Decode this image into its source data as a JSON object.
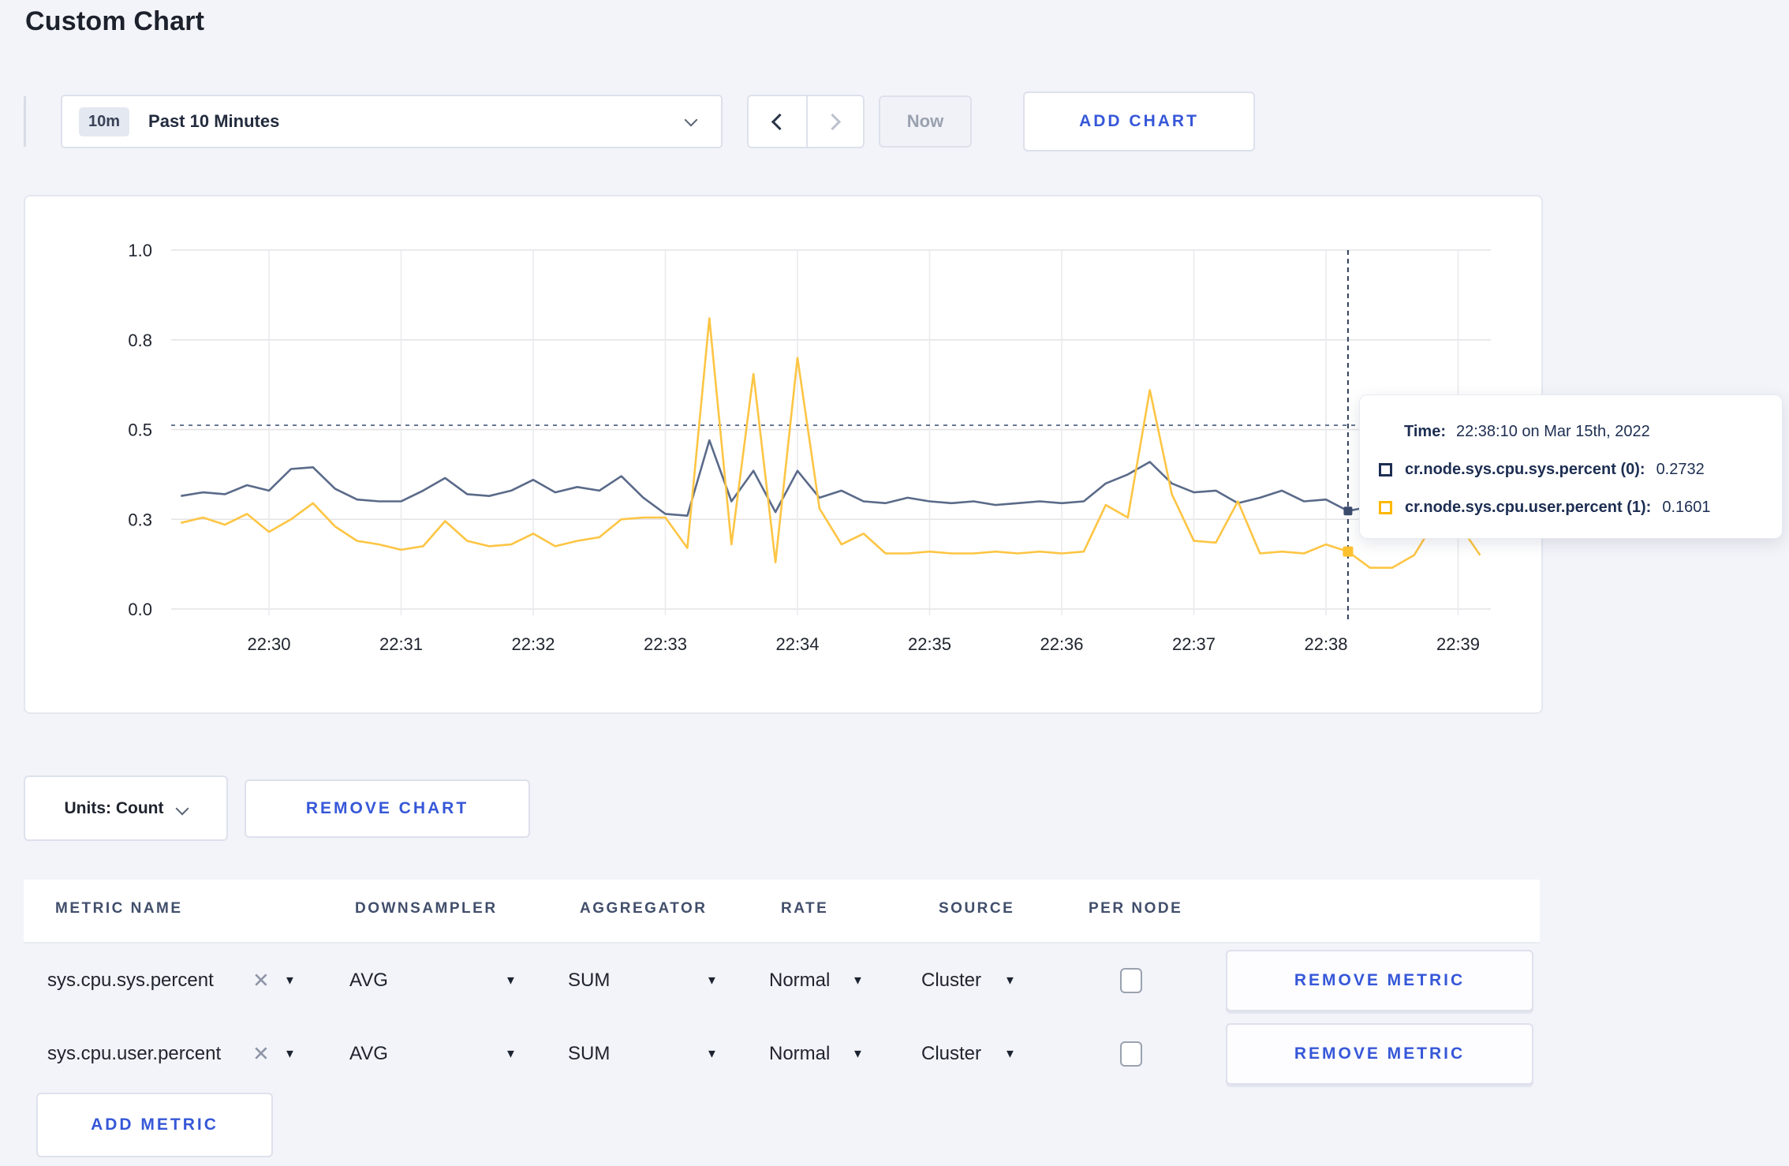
{
  "page_title": "Custom Chart",
  "toolbar": {
    "time_range_badge": "10m",
    "time_range_label": "Past 10 Minutes",
    "prev_label": "previous time window",
    "next_label": "next time window",
    "now_label": "Now",
    "add_chart_label": "ADD CHART",
    "icons": [
      "chevron-down-icon",
      "chevron-left-icon",
      "chevron-right-icon"
    ]
  },
  "chart_data": {
    "type": "line",
    "title": "",
    "xlabel": "",
    "ylabel": "",
    "ylim": [
      0,
      1
    ],
    "grid": true,
    "yticks": [
      {
        "value": 0,
        "label": "0.0"
      },
      {
        "value": 0.25,
        "label": "0.3"
      },
      {
        "value": 0.5,
        "label": "0.5"
      },
      {
        "value": 0.75,
        "label": "0.8"
      },
      {
        "value": 1,
        "label": "1.0"
      }
    ],
    "xticks": [
      "22:30",
      "22:31",
      "22:32",
      "22:33",
      "22:34",
      "22:35",
      "22:36",
      "22:37",
      "22:38",
      "22:39"
    ],
    "x": [
      "22:29:20",
      "22:29:30",
      "22:29:40",
      "22:29:50",
      "22:30:00",
      "22:30:10",
      "22:30:20",
      "22:30:30",
      "22:30:40",
      "22:30:50",
      "22:31:00",
      "22:31:10",
      "22:31:20",
      "22:31:30",
      "22:31:40",
      "22:31:50",
      "22:32:00",
      "22:32:10",
      "22:32:20",
      "22:32:30",
      "22:32:40",
      "22:32:50",
      "22:33:00",
      "22:33:10",
      "22:33:20",
      "22:33:30",
      "22:33:40",
      "22:33:50",
      "22:34:00",
      "22:34:10",
      "22:34:20",
      "22:34:30",
      "22:34:40",
      "22:34:50",
      "22:35:00",
      "22:35:10",
      "22:35:20",
      "22:35:30",
      "22:35:40",
      "22:35:50",
      "22:36:00",
      "22:36:10",
      "22:36:20",
      "22:36:30",
      "22:36:40",
      "22:36:50",
      "22:37:00",
      "22:37:10",
      "22:37:20",
      "22:37:30",
      "22:37:40",
      "22:37:50",
      "22:38:00",
      "22:38:10",
      "22:38:20",
      "22:38:30",
      "22:38:40",
      "22:38:50",
      "22:39:00",
      "22:39:10"
    ],
    "series": [
      {
        "name": "cr.node.sys.cpu.sys.percent (0)",
        "color": "#5a6a89",
        "values": [
          0.315,
          0.325,
          0.32,
          0.345,
          0.33,
          0.39,
          0.395,
          0.335,
          0.305,
          0.3,
          0.3,
          0.33,
          0.365,
          0.32,
          0.315,
          0.33,
          0.36,
          0.325,
          0.34,
          0.33,
          0.37,
          0.31,
          0.265,
          0.26,
          0.47,
          0.3,
          0.385,
          0.27,
          0.385,
          0.31,
          0.33,
          0.3,
          0.295,
          0.31,
          0.3,
          0.295,
          0.3,
          0.29,
          0.295,
          0.3,
          0.295,
          0.3,
          0.35,
          0.375,
          0.41,
          0.35,
          0.325,
          0.33,
          0.295,
          0.31,
          0.33,
          0.3,
          0.305,
          0.2732,
          0.285,
          0.29,
          0.295,
          0.3,
          0.295,
          0.3
        ]
      },
      {
        "name": "cr.node.sys.cpu.user.percent (1)",
        "color": "#fdc544",
        "values": [
          0.24,
          0.255,
          0.235,
          0.265,
          0.215,
          0.25,
          0.295,
          0.23,
          0.19,
          0.18,
          0.165,
          0.175,
          0.245,
          0.19,
          0.175,
          0.18,
          0.21,
          0.175,
          0.19,
          0.2,
          0.25,
          0.255,
          0.255,
          0.17,
          0.81,
          0.18,
          0.655,
          0.13,
          0.7,
          0.28,
          0.18,
          0.21,
          0.155,
          0.155,
          0.16,
          0.155,
          0.155,
          0.16,
          0.155,
          0.16,
          0.155,
          0.16,
          0.29,
          0.255,
          0.61,
          0.32,
          0.19,
          0.185,
          0.3,
          0.155,
          0.16,
          0.155,
          0.18,
          0.1601,
          0.115,
          0.115,
          0.15,
          0.25,
          0.24,
          0.15
        ]
      }
    ],
    "legend_position": "tooltip",
    "crosshair": {
      "time": "22:38:10",
      "hline_value": 0.512
    },
    "hover_points": [
      {
        "series": 0,
        "value": 0.2732,
        "dot_color": "#3c4c6d"
      },
      {
        "series": 1,
        "value": 0.1601,
        "dot_color": "#fdc12f"
      }
    ]
  },
  "tooltip": {
    "time_label": "Time:",
    "time_value": "22:38:10 on Mar 15th, 2022",
    "rows": [
      {
        "label": "cr.node.sys.cpu.sys.percent (0):",
        "value": "0.2732",
        "swatch_color": "#1d2e52"
      },
      {
        "label": "cr.node.sys.cpu.user.percent (1):",
        "value": "0.1601",
        "swatch_color": "#fdb800"
      }
    ]
  },
  "chart_controls": {
    "units_label": "Units: Count",
    "remove_chart_label": "REMOVE CHART"
  },
  "metrics_table": {
    "headers": [
      "METRIC NAME",
      "DOWNSAMPLER",
      "AGGREGATOR",
      "RATE",
      "SOURCE",
      "PER NODE"
    ],
    "rows": [
      {
        "metric": "sys.cpu.sys.percent",
        "close": "✕",
        "downsampler": "AVG",
        "aggregator": "SUM",
        "rate": "Normal",
        "source": "Cluster",
        "per_node_checked": false,
        "remove_label": "REMOVE METRIC"
      },
      {
        "metric": "sys.cpu.user.percent",
        "close": "✕",
        "downsampler": "AVG",
        "aggregator": "SUM",
        "rate": "Normal",
        "source": "Cluster",
        "per_node_checked": false,
        "remove_label": "REMOVE METRIC"
      }
    ],
    "add_metric_label": "ADD METRIC",
    "caret_icon": "▼"
  },
  "colors": {
    "accent_blue": "#3657d8",
    "series_sys": "#5a6a89",
    "series_user": "#fdc544",
    "page_background": "#f3f4f9"
  }
}
